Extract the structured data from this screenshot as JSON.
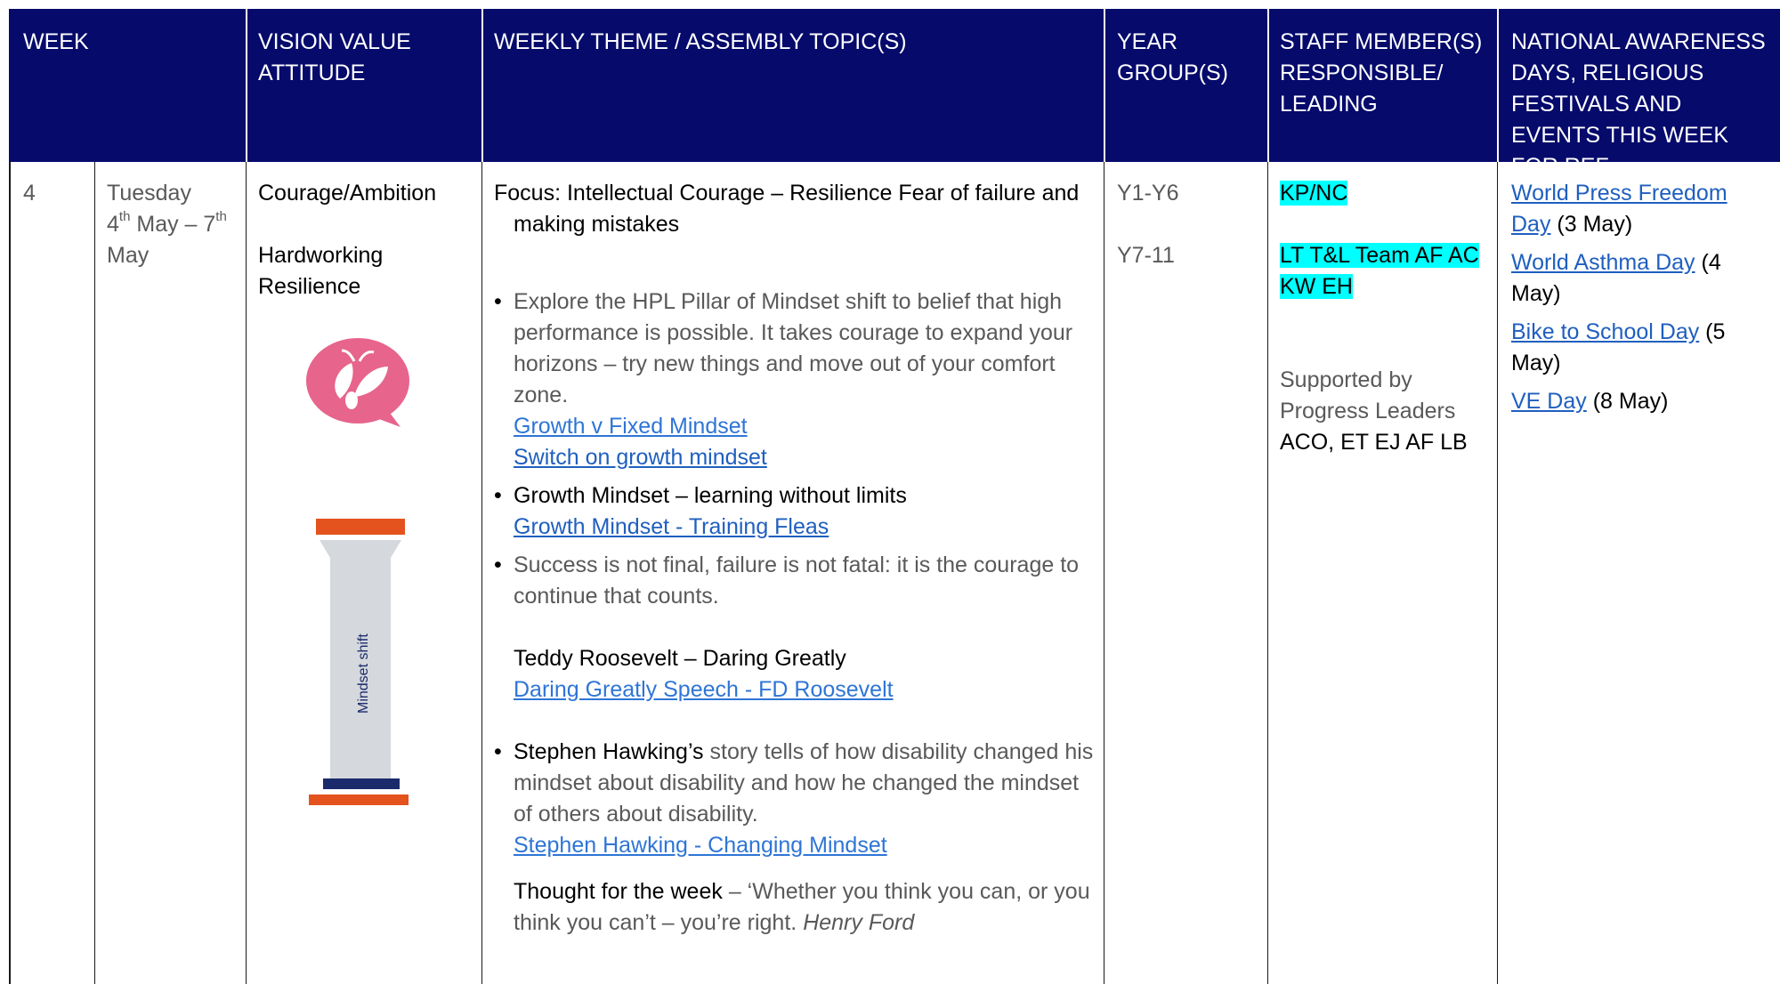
{
  "header": {
    "week": "WEEK",
    "vision": "VISION VALUE ATTITUDE",
    "theme": "WEEKLY THEME / ASSEMBLY TOPIC(S)",
    "year": "YEAR GROUP(S)",
    "staff": "STAFF MEMBER(S) RESPONSIBLE/ LEADING",
    "national": "NATIONAL AWARENESS DAYS, RELIGIOUS FESTIVALS AND EVENTS THIS WEEK FOR REF"
  },
  "row": {
    "week_number": "4",
    "date": {
      "day": "Tuesday",
      "start_num": "4",
      "start_sup": "th",
      "start_rest": " May – 7",
      "end_sup": "th",
      "end_month": "May"
    },
    "vision": {
      "line1": "Courage/Ambition",
      "line2": "Hardworking",
      "line3": "Resilience",
      "pillar_label": "Mindset shift"
    },
    "theme": {
      "focus": "Focus: Intellectual Courage – Resilience Fear of failure and making mistakes",
      "bullet1_text": "Explore the HPL Pillar of Mindset shift to belief that high performance is possible.  It takes courage to expand your horizons – try new things and move out of your comfort zone.",
      "link1": "Growth v Fixed Mindset",
      "link2": "Switch on growth mindset",
      "bullet2_text": "Growth Mindset – learning without limits",
      "link3": "Growth Mindset - Training Fleas",
      "bullet3_text": "Success is not final, failure is not fatal: it is the courage to continue that counts.",
      "roosevelt_heading": "Teddy Roosevelt – Daring Greatly",
      "link4": "Daring Greatly Speech - FD Roosevelt",
      "hawking_bold": "Stephen Hawking’s",
      "hawking_rest": " story tells of how disability changed his mindset about disability and how he changed the mindset of others about disability.",
      "link5": "Stephen Hawking - Changing Mindset",
      "thought_bold": "Thought for the week",
      "thought_rest": " – ‘Whether you think you can, or you think you can’t – you’re right.",
      "thought_author": "Henry Ford"
    },
    "years": [
      "Y1-Y6",
      "Y7-11"
    ],
    "staff": {
      "primary": "KP/NC",
      "secondary": "LT T&L Team AF AC KW EH",
      "supported_by": "Supported by Progress Leaders",
      "names": "ACO,  ET EJ AF LB"
    },
    "events": [
      {
        "link": "World Press Freedom Day",
        "date": " (3 May)"
      },
      {
        "link": "World Asthma Day",
        "date": " (4 May)"
      },
      {
        "link": "Bike to School Day",
        "date": " (5 May)"
      },
      {
        "link": "VE Day",
        "date": " (8 May)"
      }
    ]
  },
  "colors": {
    "header_bg": "#050A6B",
    "highlight": "#00FFFF",
    "link": "#2E75D6",
    "logo_pink": "#E7648C",
    "pillar_orange": "#E4531E",
    "pillar_navy": "#1B2A6B"
  },
  "icons": [
    "bee-logo-icon",
    "pillar-icon"
  ]
}
